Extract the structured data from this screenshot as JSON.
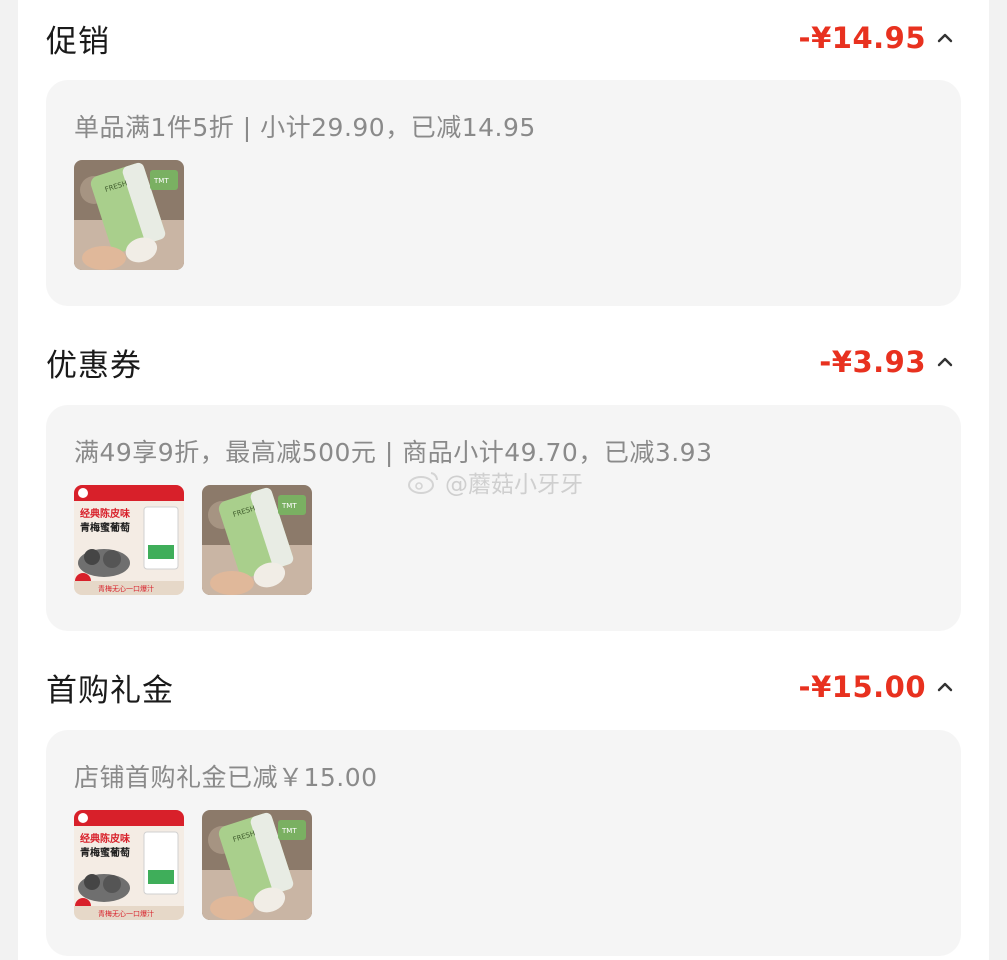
{
  "sections": [
    {
      "title": "促销",
      "amount": "-¥14.95",
      "detail": "单品满1件5折 | 小计29.90，已减14.95",
      "products": [
        "face-wash-tube"
      ]
    },
    {
      "title": "优惠券",
      "amount": "-¥3.93",
      "detail": "满49享9折，最高减500元 | 商品小计49.70，已减3.93",
      "products": [
        "plum-grape-bag",
        "face-wash-tube"
      ]
    },
    {
      "title": "首购礼金",
      "amount": "-¥15.00",
      "detail": "店铺首购礼金已减￥15.00",
      "products": [
        "plum-grape-bag",
        "face-wash-tube"
      ]
    }
  ],
  "product_labels": {
    "plum_grape": {
      "line1": "经典陈皮味",
      "line2": "青梅蜜葡萄",
      "footer": "青梅无心一口爆汁"
    },
    "face_wash": {
      "brand": "FRESH",
      "badge": "TMT"
    }
  },
  "watermark": "@蘑菇小牙牙",
  "colors": {
    "accent_red": "#e8311f",
    "card_bg": "#f5f5f5",
    "muted_text": "#8a8a8a",
    "tube_green": "#a9cf8c"
  }
}
